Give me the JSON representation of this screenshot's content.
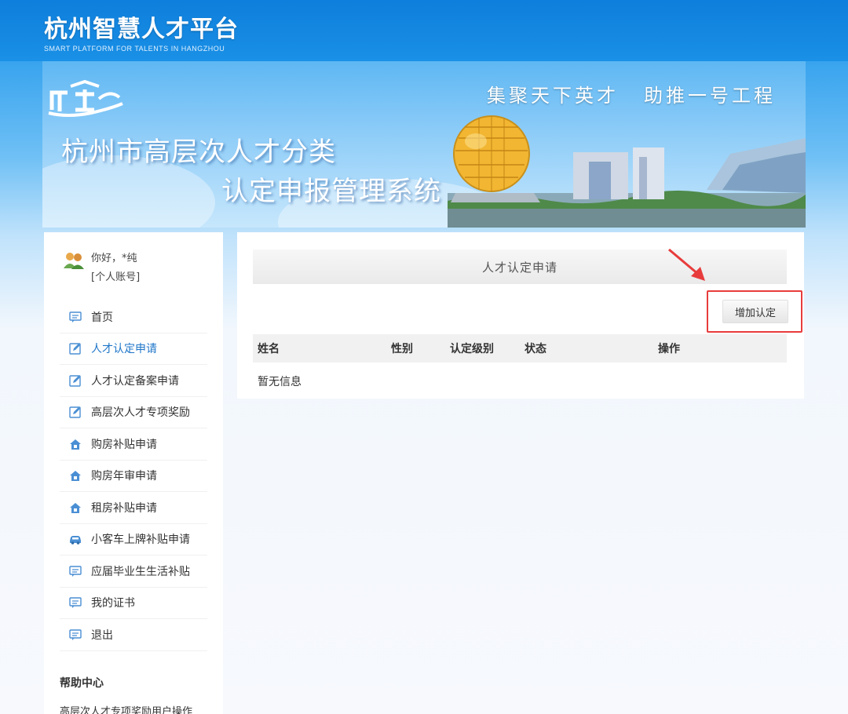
{
  "header": {
    "title": "杭州智慧人才平台",
    "subtitle": "SMART PLATFORM FOR TALENTS IN HANGZHOU"
  },
  "banner": {
    "slogan_left": "集聚天下英才",
    "slogan_right": "助推一号工程",
    "title_line1": "杭州市高层次人才分类",
    "title_line2": "认定申报管理系统"
  },
  "user": {
    "greeting": "你好，*纯",
    "account_type": "[个人账号]"
  },
  "sidebar": {
    "items": [
      {
        "label": "首页",
        "icon": "chat-icon"
      },
      {
        "label": "人才认定申请",
        "icon": "edit-icon"
      },
      {
        "label": "人才认定备案申请",
        "icon": "edit-icon"
      },
      {
        "label": "高层次人才专项奖励",
        "icon": "edit-icon"
      },
      {
        "label": "购房补贴申请",
        "icon": "house-icon"
      },
      {
        "label": "购房年审申请",
        "icon": "house-icon"
      },
      {
        "label": "租房补贴申请",
        "icon": "house-icon"
      },
      {
        "label": "小客车上牌补贴申请",
        "icon": "car-icon"
      },
      {
        "label": "应届毕业生生活补贴",
        "icon": "chat-icon"
      },
      {
        "label": "我的证书",
        "icon": "chat-icon"
      },
      {
        "label": "退出",
        "icon": "chat-icon"
      }
    ],
    "active_index": 1,
    "help_title": "帮助中心",
    "help_link": "高层次人才专项奖励用户操作"
  },
  "main": {
    "title": "人才认定申请",
    "add_button": "增加认定",
    "columns": [
      "姓名",
      "性别",
      "认定级别",
      "状态",
      "操作"
    ],
    "empty_text": "暂无信息"
  },
  "colors": {
    "brand_blue": "#1a90e6",
    "active_link": "#1f76c8",
    "highlight_red": "#e83c3c"
  }
}
